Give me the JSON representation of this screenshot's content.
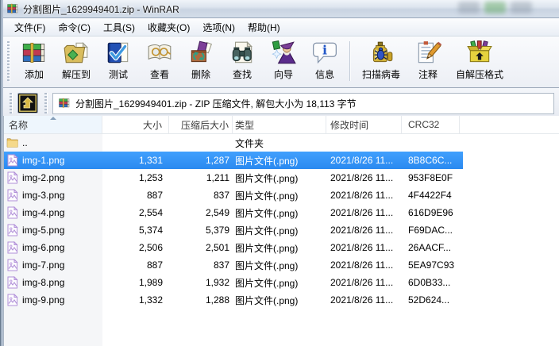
{
  "window": {
    "title": "分割图片_1629949401.zip - WinRAR"
  },
  "menu_bar": {
    "items": [
      {
        "label": "文件(F)"
      },
      {
        "label": "命令(C)"
      },
      {
        "label": "工具(S)"
      },
      {
        "label": "收藏夹(O)"
      },
      {
        "label": "选项(N)"
      },
      {
        "label": "帮助(H)"
      }
    ]
  },
  "toolbar": {
    "buttons": [
      {
        "label": "添加",
        "icon": "add-archive-icon"
      },
      {
        "label": "解压到",
        "icon": "extract-to-icon"
      },
      {
        "label": "测试",
        "icon": "test-archive-icon"
      },
      {
        "label": "查看",
        "icon": "view-file-icon"
      },
      {
        "label": "删除",
        "icon": "delete-icon"
      },
      {
        "label": "查找",
        "icon": "find-icon"
      },
      {
        "label": "向导",
        "icon": "wizard-icon"
      },
      {
        "label": "信息",
        "icon": "info-icon"
      },
      {
        "label": "扫描病毒",
        "icon": "virus-scan-icon"
      },
      {
        "label": "注释",
        "icon": "comment-icon"
      },
      {
        "label": "自解压格式",
        "icon": "sfx-icon"
      }
    ]
  },
  "address_bar": {
    "text": "分割图片_1629949401.zip - ZIP 压缩文件, 解包大小为 18,113 字节"
  },
  "file_list": {
    "columns": [
      {
        "label": "名称",
        "sorted": "ascending"
      },
      {
        "label": "大小"
      },
      {
        "label": "压缩后大小"
      },
      {
        "label": "类型"
      },
      {
        "label": "修改时间"
      },
      {
        "label": "CRC32"
      }
    ],
    "rows": [
      {
        "name": "..",
        "size": "",
        "packed": "",
        "type": "文件夹",
        "modified": "",
        "crc": "",
        "icon": "folder-icon",
        "selected": false
      },
      {
        "name": "img-1.png",
        "size": "1,331",
        "packed": "1,287",
        "type": "图片文件(.png)",
        "modified": "2021/8/26 11...",
        "crc": "8B8C6C...",
        "icon": "image-file-icon",
        "selected": true
      },
      {
        "name": "img-2.png",
        "size": "1,253",
        "packed": "1,211",
        "type": "图片文件(.png)",
        "modified": "2021/8/26 11...",
        "crc": "953F8E0F",
        "icon": "image-file-icon",
        "selected": false
      },
      {
        "name": "img-3.png",
        "size": "887",
        "packed": "837",
        "type": "图片文件(.png)",
        "modified": "2021/8/26 11...",
        "crc": "4F4422F4",
        "icon": "image-file-icon",
        "selected": false
      },
      {
        "name": "img-4.png",
        "size": "2,554",
        "packed": "2,549",
        "type": "图片文件(.png)",
        "modified": "2021/8/26 11...",
        "crc": "616D9E96",
        "icon": "image-file-icon",
        "selected": false
      },
      {
        "name": "img-5.png",
        "size": "5,374",
        "packed": "5,379",
        "type": "图片文件(.png)",
        "modified": "2021/8/26 11...",
        "crc": "F69DAC...",
        "icon": "image-file-icon",
        "selected": false
      },
      {
        "name": "img-6.png",
        "size": "2,506",
        "packed": "2,501",
        "type": "图片文件(.png)",
        "modified": "2021/8/26 11...",
        "crc": "26AACF...",
        "icon": "image-file-icon",
        "selected": false
      },
      {
        "name": "img-7.png",
        "size": "887",
        "packed": "837",
        "type": "图片文件(.png)",
        "modified": "2021/8/26 11...",
        "crc": "5EA97C93",
        "icon": "image-file-icon",
        "selected": false
      },
      {
        "name": "img-8.png",
        "size": "1,989",
        "packed": "1,932",
        "type": "图片文件(.png)",
        "modified": "2021/8/26 11...",
        "crc": "6D0B33...",
        "icon": "image-file-icon",
        "selected": false
      },
      {
        "name": "img-9.png",
        "size": "1,332",
        "packed": "1,288",
        "type": "图片文件(.png)",
        "modified": "2021/8/26 11...",
        "crc": "52D624...",
        "icon": "image-file-icon",
        "selected": false
      }
    ]
  }
}
